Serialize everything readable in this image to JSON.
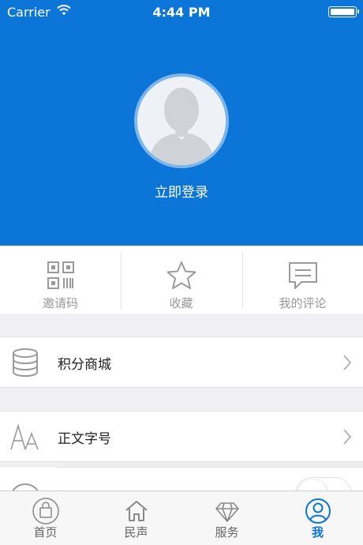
{
  "status_bar": {
    "carrier": "Carrier",
    "time": "4:44 PM"
  },
  "profile": {
    "login_label": "立即登录"
  },
  "shortcuts": [
    {
      "label": "邀请码",
      "icon": "qrcode-icon"
    },
    {
      "label": "收藏",
      "icon": "star-icon"
    },
    {
      "label": "我的评论",
      "icon": "comment-icon"
    }
  ],
  "menu": [
    {
      "label": "积分商城",
      "icon": "database-icon"
    },
    {
      "label": "正文字号",
      "icon": "font-size-icon"
    }
  ],
  "tabs": [
    {
      "label": "首页",
      "icon": "shopping-bag-icon",
      "active": false
    },
    {
      "label": "民声",
      "icon": "house-icon",
      "active": false
    },
    {
      "label": "服务",
      "icon": "diamond-icon",
      "active": false
    },
    {
      "label": "我",
      "icon": "user-icon",
      "active": true
    }
  ],
  "colors": {
    "primary": "#0b75d8",
    "background": "#efeff4",
    "muted_text": "#999999"
  }
}
